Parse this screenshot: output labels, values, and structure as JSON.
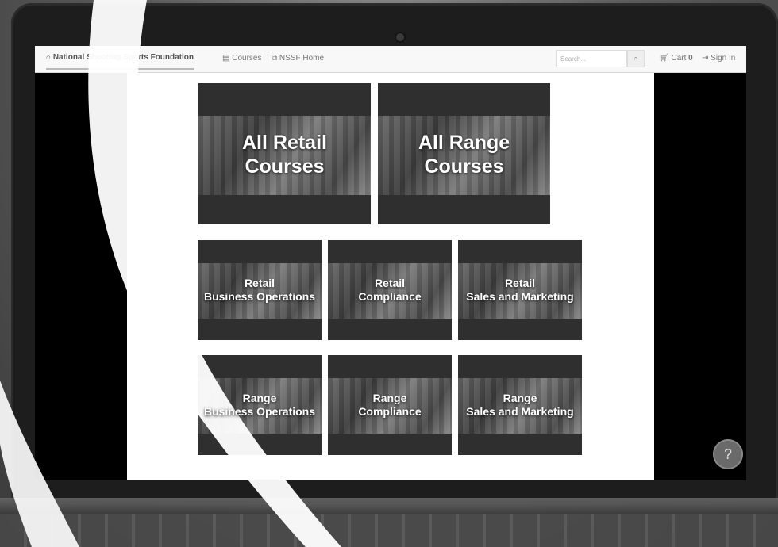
{
  "navbar": {
    "brand": "⌂ National Shooting Sports Foundation",
    "links": [
      {
        "label": "Courses",
        "icon": "book-icon"
      },
      {
        "label": "NSSF Home",
        "icon": "external-link-icon"
      }
    ],
    "search_placeholder": "Search...",
    "cart_label": "Cart",
    "cart_count": "0",
    "signin_label": "Sign In"
  },
  "tiles_large": [
    {
      "line1": "All Retail",
      "line2": "Courses"
    },
    {
      "line1": "All Range",
      "line2": "Courses"
    }
  ],
  "tiles_small": [
    {
      "line1": "Retail",
      "line2": "Business Operations"
    },
    {
      "line1": "Retail",
      "line2": "Compliance"
    },
    {
      "line1": "Retail",
      "line2": "Sales and Marketing"
    },
    {
      "line1": "Range",
      "line2": "Business Operations"
    },
    {
      "line1": "Range",
      "line2": "Compliance"
    },
    {
      "line1": "Range",
      "line2": "Sales and Marketing"
    }
  ],
  "help_label": "?",
  "colors": {
    "tile_bg": "#2f2f2f",
    "page_bg": "#ffffff",
    "navbar_bg": "#f8f8f8"
  }
}
